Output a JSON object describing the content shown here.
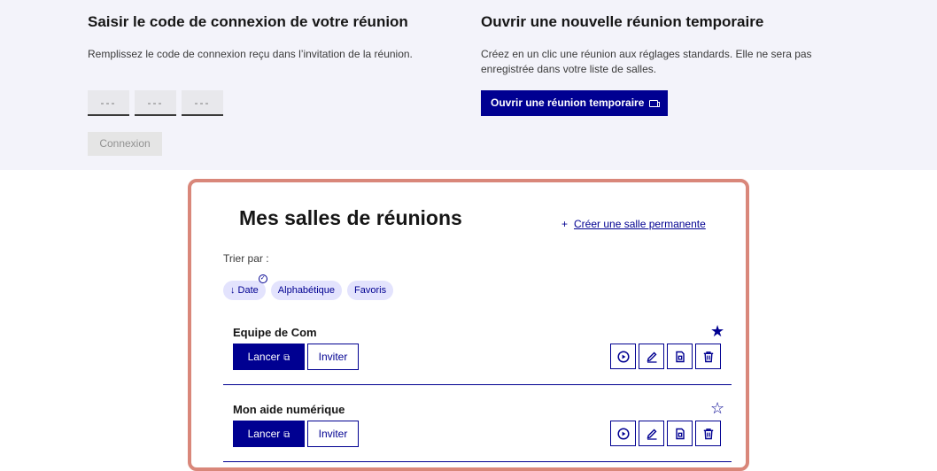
{
  "join": {
    "title": "Saisir le code de connexion de votre réunion",
    "description": "Remplissez le code de connexion reçu dans l’invitation de la réunion.",
    "code_placeholder": "---",
    "connect_label": "Connexion"
  },
  "temp": {
    "title": "Ouvrir une nouvelle réunion temporaire",
    "description": "Créez en un clic une réunion aux réglages standards. Elle ne sera pas enregistrée dans votre liste de salles.",
    "button_label": "Ouvrir une réunion temporaire"
  },
  "rooms": {
    "title": "Mes salles de réunions",
    "create_link": "Créer une salle permanente",
    "sort_label": "Trier par :",
    "sort_options": [
      "↓ Date",
      "Alphabétique",
      "Favoris"
    ],
    "launch_label": "Lancer",
    "invite_label": "Inviter",
    "items": [
      {
        "name": "Equipe de Com",
        "favorite": true
      },
      {
        "name": "Mon aide numérique",
        "favorite": false
      }
    ]
  },
  "icons": [
    "external-link-icon",
    "video-icon",
    "play-circle-icon",
    "pencil-icon",
    "document-icon",
    "trash-icon",
    "star-filled-icon",
    "star-outline-icon",
    "check-circle-icon",
    "plus-icon"
  ],
  "colors": {
    "primary": "#000091",
    "top_bg": "#f3f3fa",
    "chip_bg": "#e3e3fd",
    "highlight_border": "#d9877a"
  }
}
